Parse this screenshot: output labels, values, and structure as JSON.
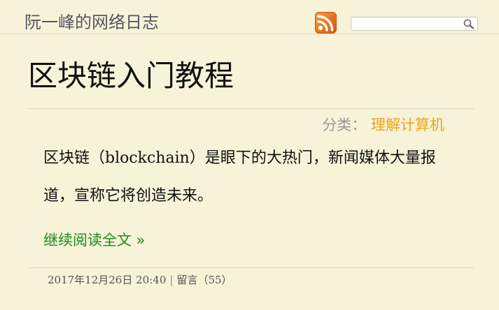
{
  "site": {
    "title": "阮一峰的网络日志"
  },
  "header": {
    "rss_icon": "rss-feed-icon",
    "search_placeholder": "",
    "search_icon": "magnifier-icon",
    "accent_rss": "#e8731c"
  },
  "post": {
    "title": "区块链入门教程",
    "category_label": "分类：",
    "category_name": "理解计算机",
    "summary": "区块链（blockchain）是眼下的大热门，新闻媒体大量报道，宣称它将创造未来。",
    "read_more": "继续阅读全文 »",
    "date": "2017年12月26日",
    "time": "20:40",
    "separator": "|",
    "comments_label": "留言",
    "comments_count": "（55）"
  },
  "colors": {
    "background": "#f6f3d8",
    "category_link": "#f0a31a",
    "read_more_link": "#1d8a1d"
  }
}
